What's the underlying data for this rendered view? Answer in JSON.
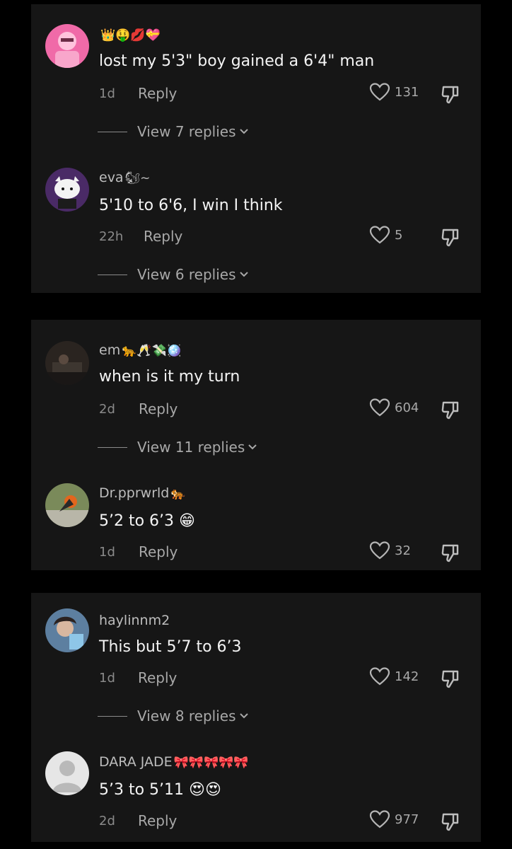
{
  "panels": [
    {
      "comments": [
        {
          "username": "",
          "badges": "👑🤑💋💝",
          "text": "lost my 5'3\" boy gained a 6'4\" man",
          "time": "1d",
          "reply_label": "Reply",
          "likes": "131",
          "view_replies": "View 7 replies",
          "avatar": "pink-avatar"
        },
        {
          "username": "eva",
          "badges": "🐿~",
          "text": "5'10 to 6'6, I win I think",
          "time": "22h",
          "reply_label": "Reply",
          "likes": "5",
          "view_replies": "View 6 replies",
          "avatar": "hello-kitty-avatar"
        }
      ]
    },
    {
      "comments": [
        {
          "username": "em",
          "badges": "🐆🥂💸🪩",
          "text": "when is it my turn",
          "time": "2d",
          "reply_label": "Reply",
          "likes": "604",
          "view_replies": "View 11 replies",
          "avatar": "dark-photo-avatar"
        },
        {
          "username": "Dr.pprwrld",
          "badges": "🐅",
          "text": "5’2 to 6’3 😁",
          "time": "1d",
          "reply_label": "Reply",
          "likes": "32",
          "view_replies": "",
          "avatar": "outdoor-photo-avatar"
        }
      ]
    },
    {
      "comments": [
        {
          "username": "haylinnm2",
          "badges": "",
          "text": "This but 5’7 to 6’3",
          "time": "1d",
          "reply_label": "Reply",
          "likes": "142",
          "view_replies": "View 8 replies",
          "avatar": "selfie-avatar"
        },
        {
          "username": "DARA JADE",
          "badges": "🎀🎀🎀🎀🎀",
          "text": "5’3 to 5’11 😍😍",
          "time": "2d",
          "reply_label": "Reply",
          "likes": "977",
          "view_replies": "",
          "avatar": "default-avatar"
        }
      ]
    }
  ],
  "colors": {
    "background": "#000000",
    "panel": "#161616",
    "primary_text": "#f4f4f4",
    "secondary_text": "#a8a8a8"
  }
}
